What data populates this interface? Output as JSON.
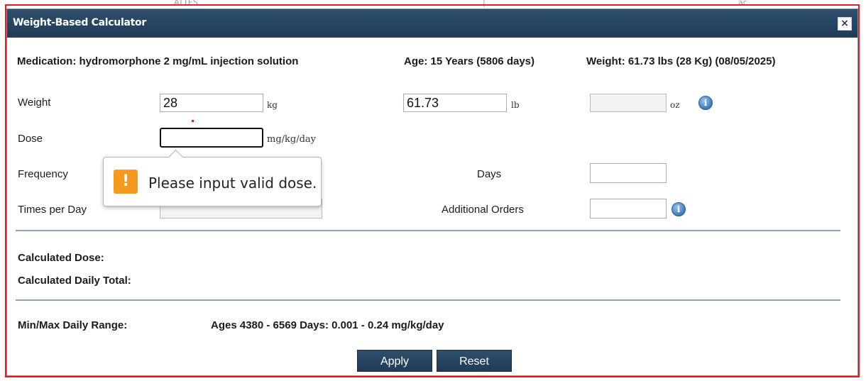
{
  "background": {
    "fragments": [
      "ATTES",
      "|",
      "ac"
    ]
  },
  "dialog": {
    "title": "Weight-Based Calculator",
    "close_glyph": "×",
    "accent_color": "#203b56"
  },
  "header": {
    "medication": "Medication: hydromorphone 2 mg/mL injection solution",
    "age": "Age: 15 Years (5806 days)",
    "weight": "Weight: 61.73 lbs (28 Kg) (08/05/2025)"
  },
  "form": {
    "weight_label": "Weight",
    "weight_kg": "28",
    "kg_unit": "kg",
    "weight_lb": "61.73",
    "lb_unit": "lb",
    "weight_oz": "",
    "oz_unit": "oz",
    "info_icon": "info-icon",
    "dose_label": "Dose",
    "dose_value": "",
    "dose_unit": "mg/kg/day",
    "frequency_label": "Frequency",
    "times_label": "Times per Day",
    "days_label": "Days",
    "days_value": "",
    "additional_label": "Additional Orders",
    "additional_value": ""
  },
  "tooltip": {
    "icon": "warning-icon",
    "glyph": "!",
    "message": "Please input valid dose.",
    "color": "#f59a1f"
  },
  "results": {
    "calc_dose_label": "Calculated Dose:",
    "calc_daily_label": "Calculated Daily Total:",
    "range_label": "Min/Max Daily Range:",
    "range_value": "Ages 4380 - 6569 Days: 0.001 - 0.24 mg/kg/day"
  },
  "buttons": {
    "apply": "Apply",
    "reset": "Reset"
  }
}
